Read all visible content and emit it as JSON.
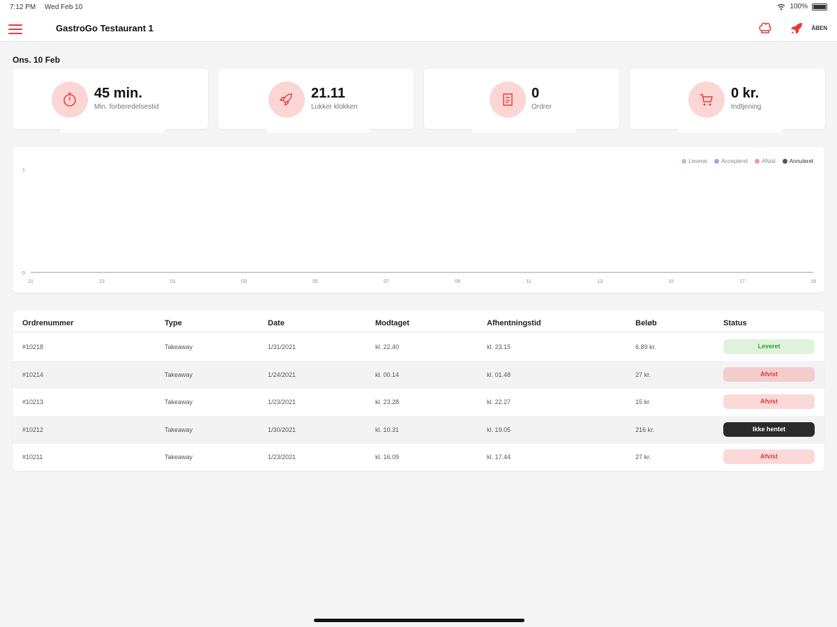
{
  "status_bar": {
    "time": "7:12 PM",
    "date": "Wed Feb 10",
    "battery": "100%"
  },
  "header": {
    "app_title": "GastroGo Testaurant 1",
    "open_label": "ÅBEN"
  },
  "page_date": "Ons. 10 Feb",
  "colors": {
    "accent": "#e53935",
    "accent_light": "#fbd6d4"
  },
  "stats": [
    {
      "icon": "stopwatch-icon",
      "value": "45 min.",
      "label": "Min. forberedelsestid"
    },
    {
      "icon": "rocket-icon",
      "value": "21.11",
      "label": "Lukker klokken"
    },
    {
      "icon": "receipt-icon",
      "value": "0",
      "label": "Ordrer"
    },
    {
      "icon": "cart-icon",
      "value": "0 kr.",
      "label": "Indtjening"
    }
  ],
  "chart_data": {
    "type": "line",
    "legend": [
      {
        "name": "Leveret",
        "color": "#a5d6a7"
      },
      {
        "name": "Accepteret",
        "color": "#9fa8da"
      },
      {
        "name": "Afvist",
        "color": "#ef9a9a"
      },
      {
        "name": "Annuleret",
        "color": "#555555"
      }
    ],
    "legend_position": "top-right",
    "x": [
      "21",
      "23",
      "01",
      "03",
      "05",
      "07",
      "09",
      "11",
      "13",
      "15",
      "17",
      "19"
    ],
    "y_ticks": [
      "0",
      "1"
    ],
    "ylim": [
      0,
      1
    ],
    "series": [],
    "grid": false
  },
  "table": {
    "columns": [
      "Ordrenummer",
      "Type",
      "Date",
      "Modtaget",
      "Afhentningstid",
      "Beløb",
      "Status"
    ],
    "rows": [
      {
        "id": "#10218",
        "type": "Takeaway",
        "date": "1/31/2021",
        "received": "kl. 22.40",
        "pickup": "kl. 23.15",
        "amount": "6.89 kr.",
        "status": "Leveret",
        "status_kind": "leveret"
      },
      {
        "id": "#10214",
        "type": "Takeaway",
        "date": "1/24/2021",
        "received": "kl. 00.14",
        "pickup": "kl. 01.48",
        "amount": "27 kr.",
        "status": "Afvist",
        "status_kind": "afvist-dark"
      },
      {
        "id": "#10213",
        "type": "Takeaway",
        "date": "1/23/2021",
        "received": "kl. 23.28",
        "pickup": "kl. 22.27",
        "amount": "15 kr.",
        "status": "Afvist",
        "status_kind": "afvist"
      },
      {
        "id": "#10212",
        "type": "Takeaway",
        "date": "1/30/2021",
        "received": "kl. 10.31",
        "pickup": "kl. 19.05",
        "amount": "216 kr.",
        "status": "Ikke hentet",
        "status_kind": "ikke"
      },
      {
        "id": "#10211",
        "type": "Takeaway",
        "date": "1/23/2021",
        "received": "kl. 16.09",
        "pickup": "kl. 17.44",
        "amount": "27 kr.",
        "status": "Afvist",
        "status_kind": "afvist"
      }
    ]
  }
}
